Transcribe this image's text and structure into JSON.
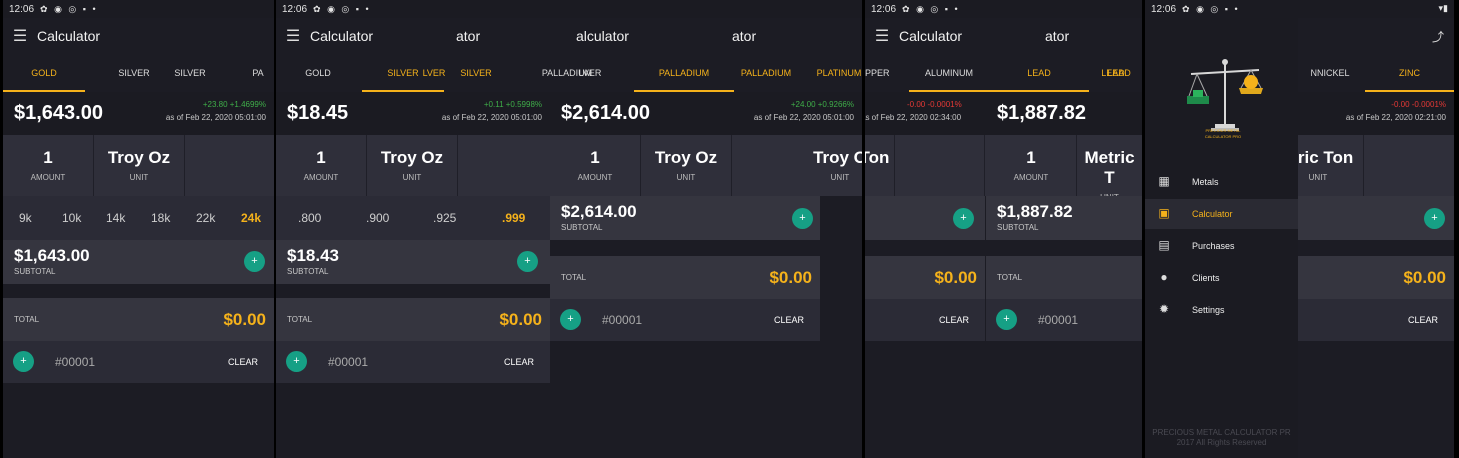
{
  "status": {
    "time": "12:06",
    "icons": "✿ ◉ ◎ ▪ •"
  },
  "app": {
    "title": "Calculator",
    "menu_icon": "☰"
  },
  "tabs": [
    "GOLD",
    "SILVER",
    "PALLADIUM",
    "PLATINUM",
    "COPPER",
    "ALUMINUM",
    "LEAD",
    "NICKEL",
    "ZINC"
  ],
  "screen1": {
    "tab_labels": [
      "GOLD",
      "SILVER",
      "SILVER",
      "PA"
    ],
    "price": "$1,643.00",
    "change": "+23.80  +1.4699%",
    "as_of": "as of Feb 22, 2020 05:01:00",
    "amount": "1",
    "amount_label": "AMOUNT",
    "unit": "Troy Oz",
    "unit_label": "UNIT",
    "purities": [
      "9k",
      "10k",
      "14k",
      "18k",
      "22k",
      "24k"
    ],
    "subtotal": "$1,643.00",
    "subtotal_label": "SUBTOTAL",
    "total_label": "TOTAL",
    "total": "$0.00",
    "invoice": "#00001",
    "clear": "CLEAR"
  },
  "screen2": {
    "tab_labels": [
      "GOLD",
      "SILVER",
      "SILVER",
      "SILVER",
      "PALLADIUM",
      "LVER",
      "PALLADIUM",
      "PALLADIUM",
      "PALLADIUM",
      "PLATINUM"
    ],
    "price": "$18.45",
    "change": "+0.11  +0.5998%",
    "as_of": "as of Feb 22, 2020 05:01:00",
    "amount": "1",
    "amount_label": "AMOUNT",
    "unit": "Troy Oz",
    "unit_label": "UNIT",
    "purities": [
      ".800",
      ".900",
      ".925",
      ".999"
    ],
    "subtotal": "$18.43",
    "subtotal_label": "SUBTOTAL",
    "total_label": "TOTAL",
    "total": "$0.00",
    "invoice": "#00001",
    "clear": "CLEAR",
    "overlay_price": "$2,614.00",
    "overlay_change": "+24.00  +0.9266%",
    "overlay_as_of": "as of Feb 22, 2020 05:01:00",
    "overlay_title": "alculator",
    "overlay_title2": "ator",
    "overlay_subtotal": "$2,614.00",
    "overlay_unit_partial": "Troy O"
  },
  "screen3": {
    "tab_labels": [
      "PPER",
      "ALUMINUM",
      "LEAD",
      "LEAD",
      "LEAD"
    ],
    "title_partial": "ator",
    "change": "-0.00  -0.0001%",
    "as_of": "as of Feb 22, 2020 02:34:00",
    "price": "$1,887.82",
    "amount": "1",
    "amount_label": "AMOUNT",
    "unit": "Metric T",
    "unit_partial": "Ton",
    "unit_label": "UNIT",
    "subtotal": "$1,887.82",
    "subtotal_label": "SUBTOTAL",
    "total_label": "TOTAL",
    "total": "$0.00",
    "invoice": "#00001",
    "clear": "CLEAR"
  },
  "screen4": {
    "tab_labels": [
      "NNICKEL",
      "ZINC"
    ],
    "change": "-0.00  -0.0001%",
    "as_of": "as of Feb 22, 2020 02:21:00",
    "unit": "etric Ton",
    "unit_label": "UNIT",
    "total": "$0.00",
    "clear": "CLEAR",
    "drawer": {
      "items": [
        {
          "label": "Metals",
          "icon": "▦"
        },
        {
          "label": "Calculator",
          "icon": "▣"
        },
        {
          "label": "Purchases",
          "icon": "▤"
        },
        {
          "label": "Clients",
          "icon": "●"
        },
        {
          "label": "Settings",
          "icon": "✹"
        }
      ],
      "footer_line1": "PRECIOUS METAL CALCULATOR PR",
      "footer_line2": "2017 All Rights Reserved",
      "logo_text": "PRECIOUS METAL CALCULATOR PRO"
    }
  },
  "colors": {
    "accent": "#f5b21b",
    "fab": "#16a085",
    "up": "#3fae49",
    "down": "#e53935"
  }
}
